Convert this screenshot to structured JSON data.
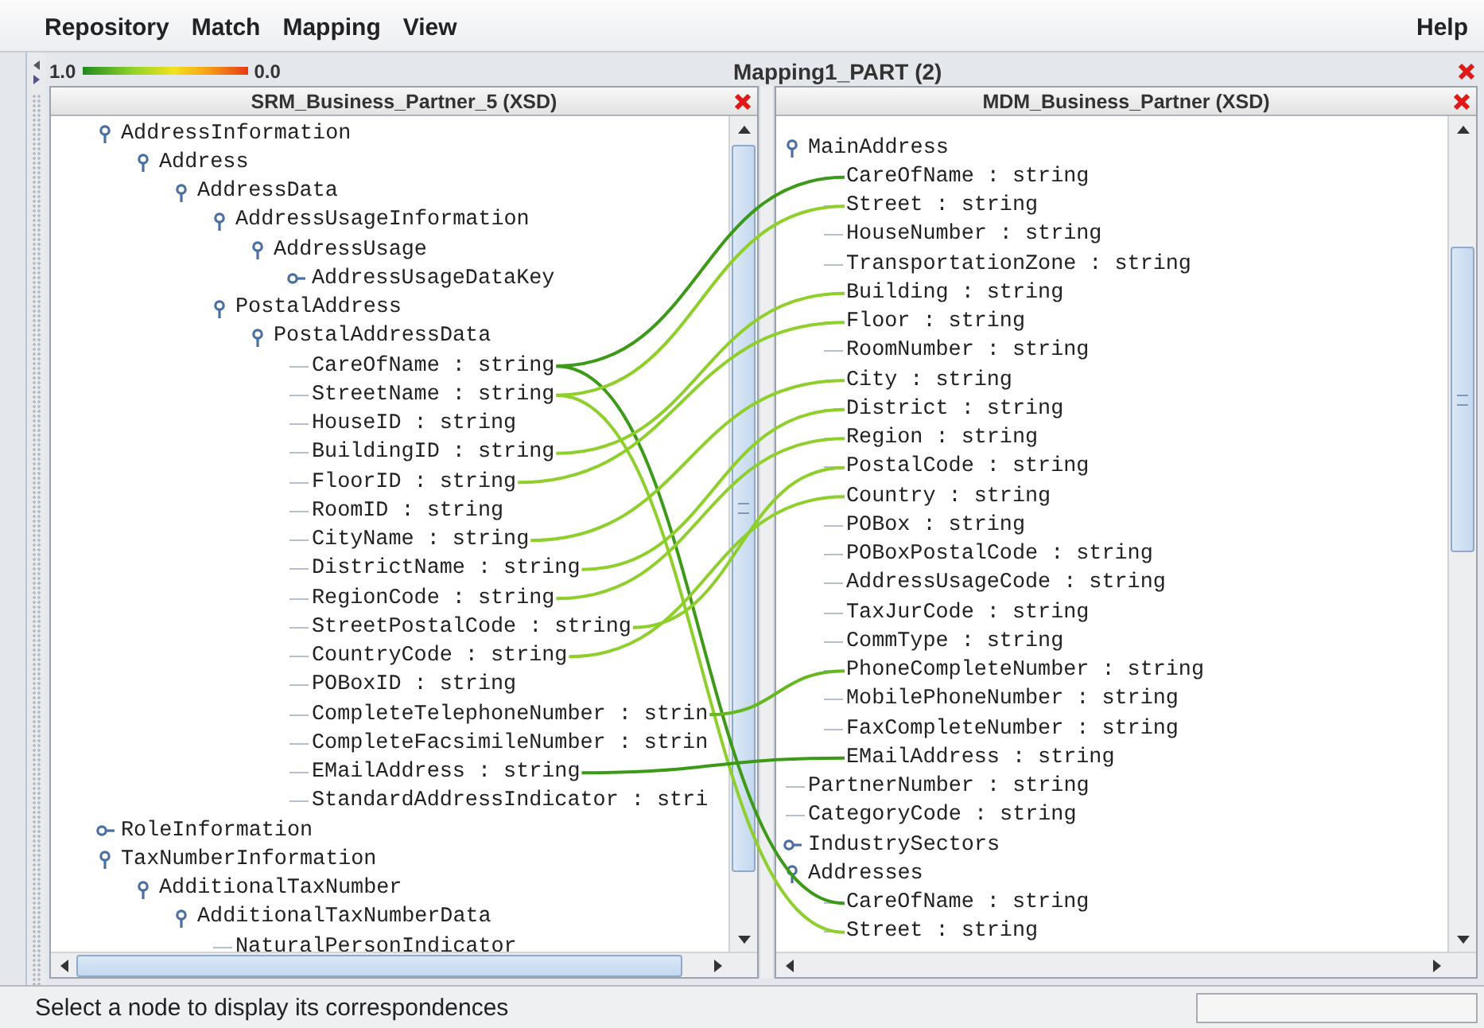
{
  "menu": [
    "Repository",
    "Match",
    "Mapping",
    "View"
  ],
  "help": "Help",
  "legend": {
    "high": "1.0",
    "low": "0.0"
  },
  "title": "Mapping1_PART (2)",
  "source": {
    "title": "SRM_Business_Partner_5 (XSD)",
    "tree": [
      {
        "label": "AddressInformation",
        "expanded": true,
        "children": [
          {
            "label": "Address",
            "expanded": true,
            "children": [
              {
                "label": "AddressData",
                "expanded": true,
                "children": [
                  {
                    "label": "AddressUsageInformation",
                    "expanded": true,
                    "children": [
                      {
                        "label": "AddressUsage",
                        "expanded": true,
                        "children": [
                          {
                            "label": "AddressUsageDataKey",
                            "expanded": false
                          }
                        ]
                      }
                    ]
                  },
                  {
                    "label": "PostalAddress",
                    "expanded": true,
                    "children": [
                      {
                        "label": "PostalAddressData",
                        "expanded": true,
                        "children": [
                          {
                            "label": "CareOfName : string"
                          },
                          {
                            "label": "StreetName : string"
                          },
                          {
                            "label": "HouseID : string"
                          },
                          {
                            "label": "BuildingID : string"
                          },
                          {
                            "label": "FloorID : string"
                          },
                          {
                            "label": "RoomID : string"
                          },
                          {
                            "label": "CityName : string"
                          },
                          {
                            "label": "DistrictName : string"
                          },
                          {
                            "label": "RegionCode : string"
                          },
                          {
                            "label": "StreetPostalCode : string"
                          },
                          {
                            "label": "CountryCode : string"
                          },
                          {
                            "label": "POBoxID : string"
                          },
                          {
                            "label": "CompleteTelephoneNumber : strin"
                          },
                          {
                            "label": "CompleteFacsimileNumber : strin"
                          },
                          {
                            "label": "EMailAddress : string"
                          },
                          {
                            "label": "StandardAddressIndicator : stri"
                          }
                        ]
                      }
                    ]
                  }
                ]
              }
            ]
          }
        ]
      },
      {
        "label": "RoleInformation",
        "expanded": false
      },
      {
        "label": "TaxNumberInformation",
        "expanded": true,
        "children": [
          {
            "label": "AdditionalTaxNumber",
            "expanded": true,
            "children": [
              {
                "label": "AdditionalTaxNumberData",
                "expanded": true,
                "children": [
                  {
                    "label": "NaturalPersonIndicator"
                  }
                ]
              }
            ]
          }
        ]
      }
    ]
  },
  "target": {
    "title": "MDM_Business_Partner (XSD)",
    "tree": [
      {
        "label": "MainAddress",
        "expanded": true,
        "children": [
          {
            "label": "CareOfName : string"
          },
          {
            "label": "Street : string"
          },
          {
            "label": "HouseNumber : string"
          },
          {
            "label": "TransportationZone : string"
          },
          {
            "label": "Building : string"
          },
          {
            "label": "Floor : string"
          },
          {
            "label": "RoomNumber : string"
          },
          {
            "label": "City : string"
          },
          {
            "label": "District : string"
          },
          {
            "label": "Region : string"
          },
          {
            "label": "PostalCode : string"
          },
          {
            "label": "Country : string"
          },
          {
            "label": "POBox : string"
          },
          {
            "label": "POBoxPostalCode : string"
          },
          {
            "label": "AddressUsageCode : string"
          },
          {
            "label": "TaxJurCode : string"
          },
          {
            "label": "CommType : string"
          },
          {
            "label": "PhoneCompleteNumber : string"
          },
          {
            "label": "MobilePhoneNumber : string"
          },
          {
            "label": "FaxCompleteNumber : string"
          },
          {
            "label": "EMailAddress : string"
          }
        ]
      },
      {
        "label": "PartnerNumber : string"
      },
      {
        "label": "CategoryCode : string"
      },
      {
        "label": "IndustrySectors",
        "expanded": false
      },
      {
        "label": "Addresses",
        "expanded": true,
        "children": [
          {
            "label": "CareOfName : string"
          },
          {
            "label": "Street : string"
          }
        ]
      }
    ]
  },
  "status": "Select a node to display its correspondences"
}
